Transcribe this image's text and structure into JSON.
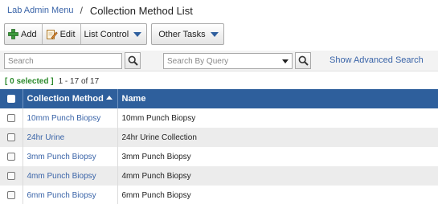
{
  "breadcrumb": {
    "parent": "Lab Admin Menu",
    "separator": "/",
    "title": "Collection Method List"
  },
  "toolbar": {
    "add_label": "Add",
    "edit_label": "Edit",
    "list_control_label": "List Control",
    "other_tasks_label": "Other Tasks"
  },
  "search": {
    "placeholder": "Search",
    "query_placeholder": "Search By Query",
    "advanced_link": "Show Advanced Search"
  },
  "selection": {
    "selected": "[ 0 selected ]",
    "range": "1 - 17 of 17"
  },
  "table": {
    "headers": {
      "method": "Collection Method",
      "name": "Name"
    },
    "rows": [
      {
        "method": "10mm Punch Biopsy",
        "name": "10mm Punch Biopsy"
      },
      {
        "method": "24hr Urine",
        "name": "24hr Urine Collection"
      },
      {
        "method": "3mm Punch Biopsy",
        "name": "3mm Punch Biopsy"
      },
      {
        "method": "4mm Punch Biopsy",
        "name": "4mm Punch Biopsy"
      },
      {
        "method": "6mm Punch Biopsy",
        "name": "6mm Punch Biopsy"
      }
    ]
  },
  "colors": {
    "header_bg": "#2e5f9c",
    "link": "#3a64a8",
    "selected": "#2c8a2c",
    "add_icon": "#3c9a3c"
  }
}
